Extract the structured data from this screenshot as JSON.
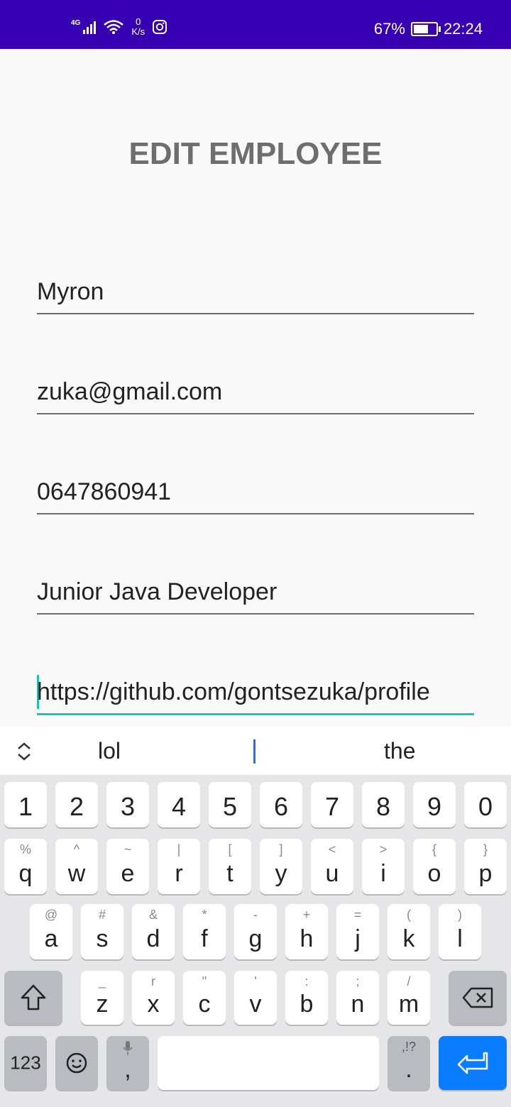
{
  "status": {
    "network": "4G",
    "speed_value": "0",
    "speed_unit": "K/s",
    "battery": "67%",
    "battery_level": 0.67,
    "time": "22:24"
  },
  "title": "EDIT EMPLOYEE",
  "fields": [
    {
      "value": "Myron"
    },
    {
      "value": "zuka@gmail.com"
    },
    {
      "value": "0647860941"
    },
    {
      "value": "Junior Java Developer"
    },
    {
      "value": "https://github.com/gontsezuka/profile"
    }
  ],
  "suggestions": [
    "lol",
    "the"
  ],
  "keyboard": {
    "numbers": [
      "1",
      "2",
      "3",
      "4",
      "5",
      "6",
      "7",
      "8",
      "9",
      "0"
    ],
    "row1": [
      [
        "q",
        "%"
      ],
      [
        "w",
        "^"
      ],
      [
        "e",
        "~"
      ],
      [
        "r",
        "|"
      ],
      [
        "t",
        "["
      ],
      [
        "y",
        "]"
      ],
      [
        "u",
        "<"
      ],
      [
        "i",
        ">"
      ],
      [
        "o",
        "{"
      ],
      [
        "p",
        "}"
      ]
    ],
    "row2": [
      [
        "a",
        "@"
      ],
      [
        "s",
        "#"
      ],
      [
        "d",
        "&"
      ],
      [
        "f",
        "*"
      ],
      [
        "g",
        "-"
      ],
      [
        "h",
        "+"
      ],
      [
        "j",
        "="
      ],
      [
        "k",
        "("
      ],
      [
        "l",
        ")"
      ]
    ],
    "row3": [
      [
        "z",
        "_"
      ],
      [
        "x",
        "r"
      ],
      [
        "c",
        "\""
      ],
      [
        "v",
        "'"
      ],
      [
        "b",
        ":"
      ],
      [
        "n",
        ";"
      ],
      [
        "m",
        "/"
      ]
    ],
    "mode_label": "123",
    "comma": ",",
    "period": ".",
    "period_sub": ",!?"
  },
  "colors": {
    "statusbar": "#3700b3",
    "accent": "#1cc4b4",
    "enter": "#0a7cff"
  }
}
